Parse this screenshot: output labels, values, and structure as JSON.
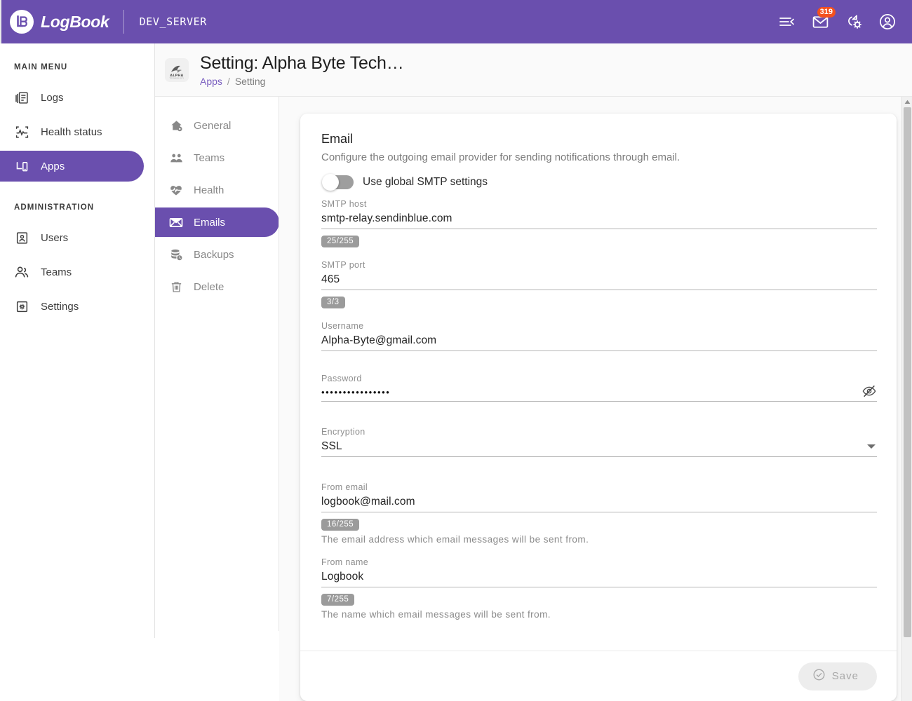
{
  "topbar": {
    "brand_name": "LogBook",
    "server_name": "DEV_SERVER",
    "icons": {
      "collapse": "collapse-menu-icon",
      "mail": "mail-icon",
      "mail_badge": "319",
      "restore": "restore-settings-icon",
      "account": "account-circle-icon"
    }
  },
  "sidebar": {
    "sections": [
      {
        "label": "MAIN MENU",
        "items": [
          {
            "label": "Logs",
            "icon": "logs-icon",
            "active": false
          },
          {
            "label": "Health status",
            "icon": "health-status-icon",
            "active": false
          },
          {
            "label": "Apps",
            "icon": "apps-icon",
            "active": true
          }
        ]
      },
      {
        "label": "ADMINISTRATION",
        "items": [
          {
            "label": "Users",
            "icon": "user-icon",
            "active": false
          },
          {
            "label": "Teams",
            "icon": "teams-icon",
            "active": false
          },
          {
            "label": "Settings",
            "icon": "gear-icon",
            "active": false
          }
        ]
      }
    ]
  },
  "page": {
    "title": "Setting: Alpha Byte Tech…",
    "avatar_alt": "ALPHA",
    "breadcrumb": {
      "parent": "Apps",
      "separator": "/",
      "current": "Setting"
    }
  },
  "settings_nav": {
    "items": [
      {
        "label": "General",
        "icon": "home-gear-icon",
        "active": false
      },
      {
        "label": "Teams",
        "icon": "teams-icon",
        "active": false
      },
      {
        "label": "Health",
        "icon": "heart-pulse-icon",
        "active": false
      },
      {
        "label": "Emails",
        "icon": "envelope-icon",
        "active": true
      },
      {
        "label": "Backups",
        "icon": "database-backup-icon",
        "active": false
      },
      {
        "label": "Delete",
        "icon": "trash-icon",
        "active": false
      }
    ]
  },
  "email_form": {
    "section_title": "Email",
    "section_subtitle": "Configure the outgoing email provider for sending notifications through email.",
    "global_smtp": {
      "label": "Use global SMTP settings",
      "enabled": false
    },
    "fields": [
      {
        "label": "SMTP host",
        "value": "smtp-relay.sendinblue.com",
        "counter": "25/255",
        "hint": ""
      },
      {
        "label": "SMTP port",
        "value": "465",
        "counter": "3/3",
        "hint": ""
      },
      {
        "label": "Username",
        "value": "Alpha-Byte@gmail.com",
        "counter": "",
        "hint": ""
      },
      {
        "label": "Password",
        "value": "••••••••••••••••",
        "counter": "",
        "hint": "",
        "trailing_icon": "eye-off-icon"
      },
      {
        "label": "Encryption",
        "value": "SSL",
        "counter": "",
        "hint": "",
        "trailing_icon": "chevron-down-icon"
      },
      {
        "label": "From email",
        "value": "logbook@mail.com",
        "counter": "16/255",
        "hint": "The email address which email messages will be sent from."
      },
      {
        "label": "From name",
        "value": "Logbook",
        "counter": "7/255",
        "hint": "The name which email messages will be sent from."
      }
    ],
    "save_label": "Save",
    "save_icon": "check-circle-icon"
  },
  "colors": {
    "brand_purple": "#6a4fae",
    "badge_red": "#f4511e",
    "chip_gray": "#9b9b9b",
    "link_purple": "#7a5fc0"
  }
}
